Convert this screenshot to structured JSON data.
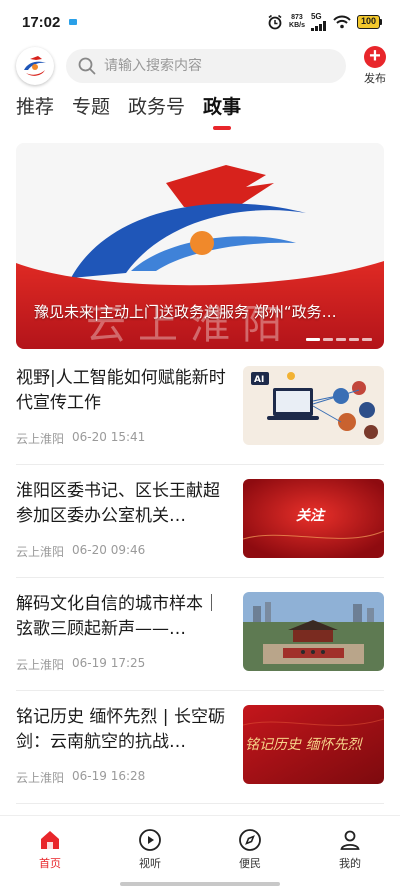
{
  "status_bar": {
    "time": "17:02",
    "net_speed_value": "873",
    "net_speed_unit": "KB/s",
    "signal_label": "5G",
    "battery": "100"
  },
  "header": {
    "search_placeholder": "请输入搜索内容",
    "publish_label": "发布"
  },
  "tabs": [
    {
      "label": "推荐",
      "active": false
    },
    {
      "label": "专题",
      "active": false
    },
    {
      "label": "政务号",
      "active": false
    },
    {
      "label": "政事",
      "active": true
    }
  ],
  "banner": {
    "caption": "豫见未来|主动上门送政务送服务 郑州“政务…",
    "logo_text": "云上淮阳",
    "dots": 5
  },
  "news": [
    {
      "title": "视野|人工智能如何赋能新时代宣传工作",
      "source": "云上淮阳",
      "time": "06-20 15:41",
      "thumb_text": "AI"
    },
    {
      "title": "淮阳区委书记、区长王献超参加区委办公室机关…",
      "source": "云上淮阳",
      "time": "06-20 09:46",
      "thumb_text": "关注"
    },
    {
      "title": "解码文化自信的城市样本｜弦歌三顾起新声——…",
      "source": "云上淮阳",
      "time": "06-19 17:25",
      "thumb_text": ""
    },
    {
      "title": "铭记历史 缅怀先烈 | 长空砺剑：云南航空的抗战…",
      "source": "云上淮阳",
      "time": "06-19 16:28",
      "thumb_text": "铭记历史 缅怀先烈"
    }
  ],
  "bottom_nav": [
    {
      "label": "首页",
      "icon": "home-icon",
      "active": true
    },
    {
      "label": "视听",
      "icon": "play-icon",
      "active": false
    },
    {
      "label": "便民",
      "icon": "compass-icon",
      "active": false
    },
    {
      "label": "我的",
      "icon": "user-icon",
      "active": false
    }
  ],
  "colors": {
    "accent": "#e8262b",
    "text": "#1a1a1a",
    "meta": "#9a9a9a"
  }
}
